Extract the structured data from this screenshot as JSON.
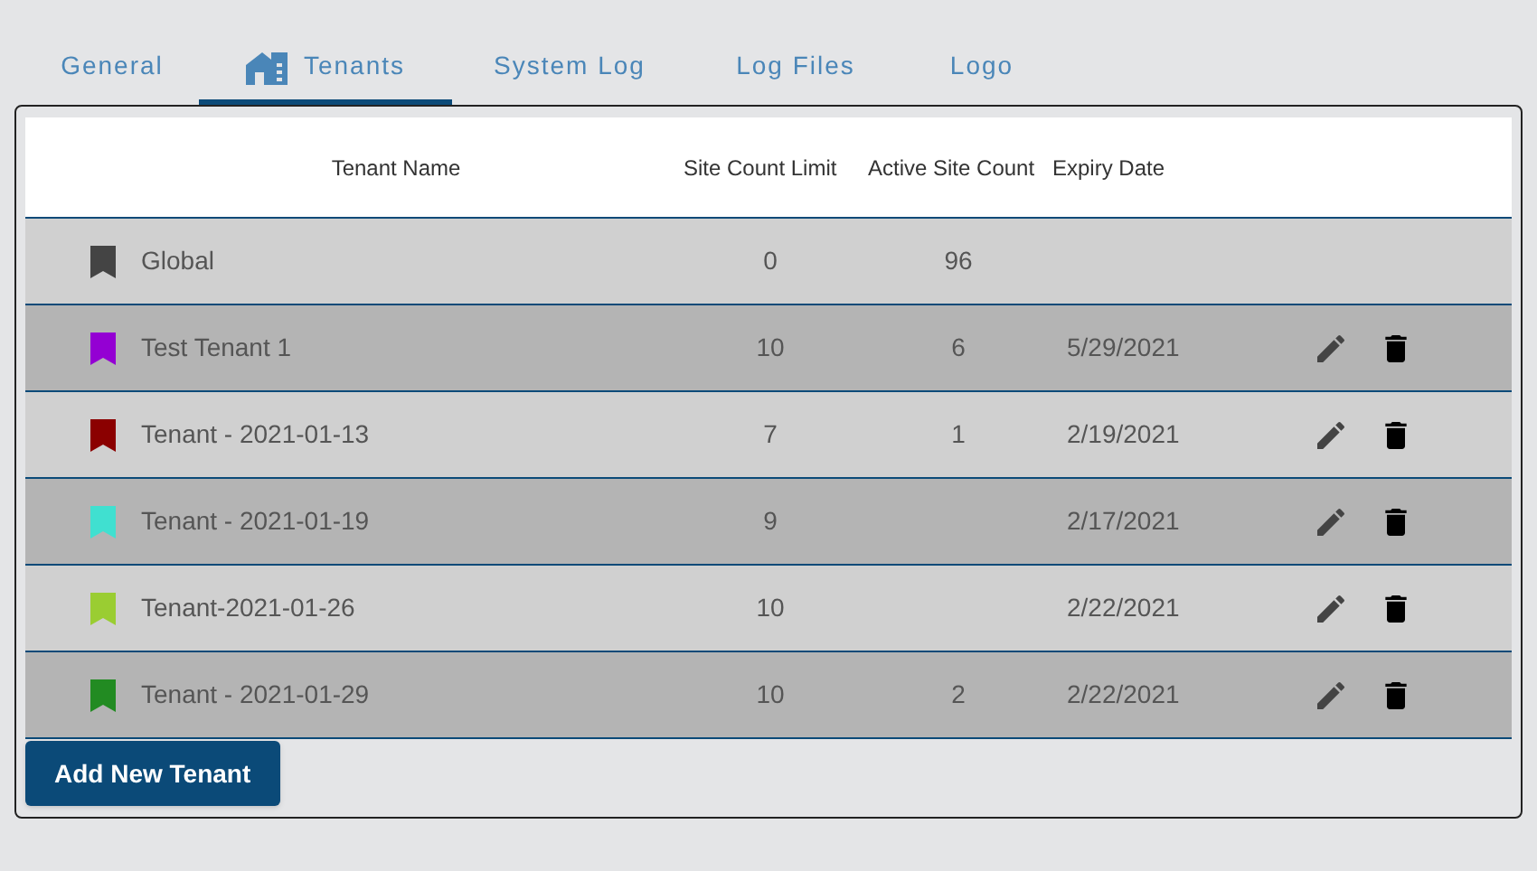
{
  "tabs": [
    {
      "label": "General",
      "selected": false,
      "icon": false
    },
    {
      "label": "Tenants",
      "selected": true,
      "icon": true
    },
    {
      "label": "System Log",
      "selected": false,
      "icon": false
    },
    {
      "label": "Log Files",
      "selected": false,
      "icon": false
    },
    {
      "label": "Logo",
      "selected": false,
      "icon": false
    }
  ],
  "table": {
    "columns": [
      "Tenant Name",
      "Site Count Limit",
      "Active Site Count",
      "Expiry Date"
    ],
    "rows": [
      {
        "name": "Global",
        "color": "#444444",
        "site_count_limit": "0",
        "active_site_count": "96",
        "expiry_date": "",
        "editable": false
      },
      {
        "name": "Test Tenant 1",
        "color": "#9400d3",
        "site_count_limit": "10",
        "active_site_count": "6",
        "expiry_date": "5/29/2021",
        "editable": true
      },
      {
        "name": "Tenant - 2021-01-13",
        "color": "#8b0000",
        "site_count_limit": "7",
        "active_site_count": "1",
        "expiry_date": "2/19/2021",
        "editable": true
      },
      {
        "name": "Tenant - 2021-01-19",
        "color": "#40e0d0",
        "site_count_limit": "9",
        "active_site_count": "",
        "expiry_date": "2/17/2021",
        "editable": true
      },
      {
        "name": "Tenant-2021-01-26",
        "color": "#9acd32",
        "site_count_limit": "10",
        "active_site_count": "",
        "expiry_date": "2/22/2021",
        "editable": true
      },
      {
        "name": "Tenant - 2021-01-29",
        "color": "#228b22",
        "site_count_limit": "10",
        "active_site_count": "2",
        "expiry_date": "2/22/2021",
        "editable": true
      }
    ]
  },
  "add_button": "Add New Tenant"
}
